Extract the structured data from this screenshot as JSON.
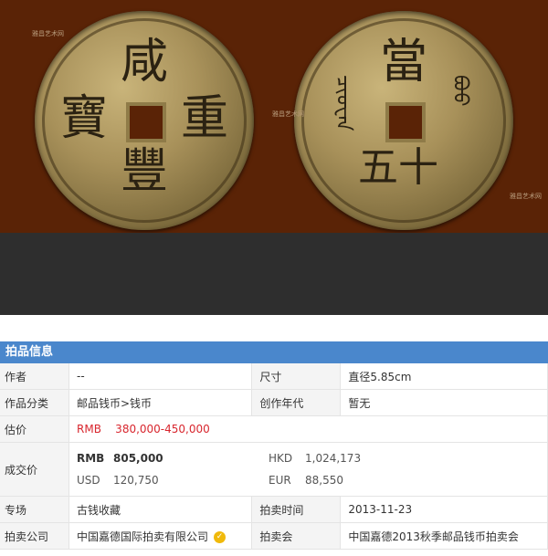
{
  "coins": {
    "left": {
      "top": "咸",
      "bottom": "豐",
      "right": "重",
      "left": "寶"
    },
    "right": {
      "top": "當",
      "bottom": "五十",
      "right": "ᠪᠣᠣ",
      "left": "ᠴᡳᠣᠸᠠᠨ"
    }
  },
  "watermark": "雅昌艺术网",
  "section_title": "拍品信息",
  "rows": {
    "author_label": "作者",
    "author_value": "--",
    "size_label": "尺寸",
    "size_value": "直径5.85cm",
    "category_label": "作品分类",
    "category_value": "邮品钱币>钱币",
    "year_label": "创作年代",
    "year_value": "暂无",
    "estimate_label": "估价",
    "estimate_value": "RMB    380,000-450,000",
    "deal_label": "成交价",
    "rmb_cur": "RMB",
    "rmb_val": "805,000",
    "hkd_cur": "HKD",
    "hkd_val": "1,024,173",
    "usd_cur": "USD",
    "usd_val": "120,750",
    "eur_cur": "EUR",
    "eur_val": "88,550",
    "session_label": "专场",
    "session_value": "古钱收藏",
    "time_label": "拍卖时间",
    "time_value": "2013-11-23",
    "company_label": "拍卖公司",
    "company_value": "中国嘉德国际拍卖有限公司",
    "auction_label": "拍卖会",
    "auction_value": "中国嘉德2013秋季邮品钱币拍卖会"
  }
}
